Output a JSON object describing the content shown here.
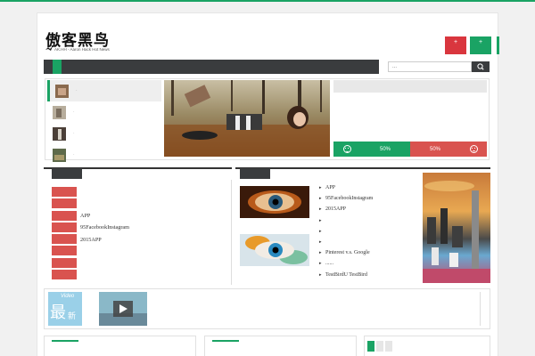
{
  "site": {
    "title": "傲客黑鸟",
    "subtitle": "AK.HH - Aaron Hack Hot News"
  },
  "header": {
    "button_red_label": "+",
    "button_green_label": "+"
  },
  "search": {
    "placeholder": "..."
  },
  "slider": {
    "thumbs": [
      {
        "label": "·"
      },
      {
        "label": "·"
      },
      {
        "label": "·"
      },
      {
        "label": "·"
      }
    ],
    "vote": {
      "up": "50%",
      "down": "50%"
    }
  },
  "left_column": {
    "links": [
      "APP",
      "95FacebookInstagram",
      "2015APP"
    ]
  },
  "middle_column": {
    "links": [
      "APP",
      "95FacebookInstagram",
      "2015APP",
      "",
      "",
      "",
      "Pinterest v.s. Google",
      "......",
      "TestBirdU  TestBird"
    ]
  },
  "video": {
    "badge_top": "Video",
    "badge_main": "最",
    "badge_small": "新"
  },
  "colors": {
    "accent_green": "#1aa364",
    "accent_red": "#d9534f",
    "nav_dark": "#3a3c3e"
  }
}
